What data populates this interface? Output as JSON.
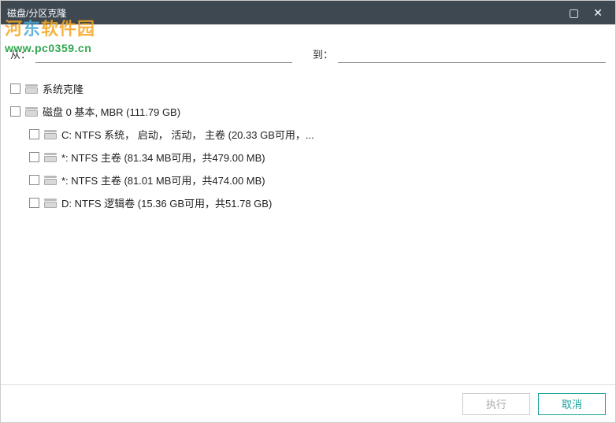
{
  "window": {
    "title": "磁盘/分区克隆"
  },
  "watermark": {
    "brand_prefix": "河",
    "brand_mid": "东",
    "brand_suffix": "软件园",
    "url": "www.pc0359.cn"
  },
  "headers": {
    "from": "从：",
    "to": "到："
  },
  "tree": {
    "items": [
      {
        "label": "系统克隆",
        "indent": 0
      },
      {
        "label": "磁盘 0 基本, MBR (111.79 GB)",
        "indent": 0
      },
      {
        "label": "C: NTFS 系统， 启动， 活动， 主卷 (20.33 GB可用，...",
        "indent": 1
      },
      {
        "label": "*: NTFS 主卷 (81.34 MB可用，共479.00 MB)",
        "indent": 1
      },
      {
        "label": "*: NTFS 主卷 (81.01 MB可用，共474.00 MB)",
        "indent": 1
      },
      {
        "label": "D: NTFS 逻辑卷 (15.36 GB可用，共51.78 GB)",
        "indent": 1
      }
    ]
  },
  "footer": {
    "execute": "执行",
    "cancel": "取消"
  }
}
